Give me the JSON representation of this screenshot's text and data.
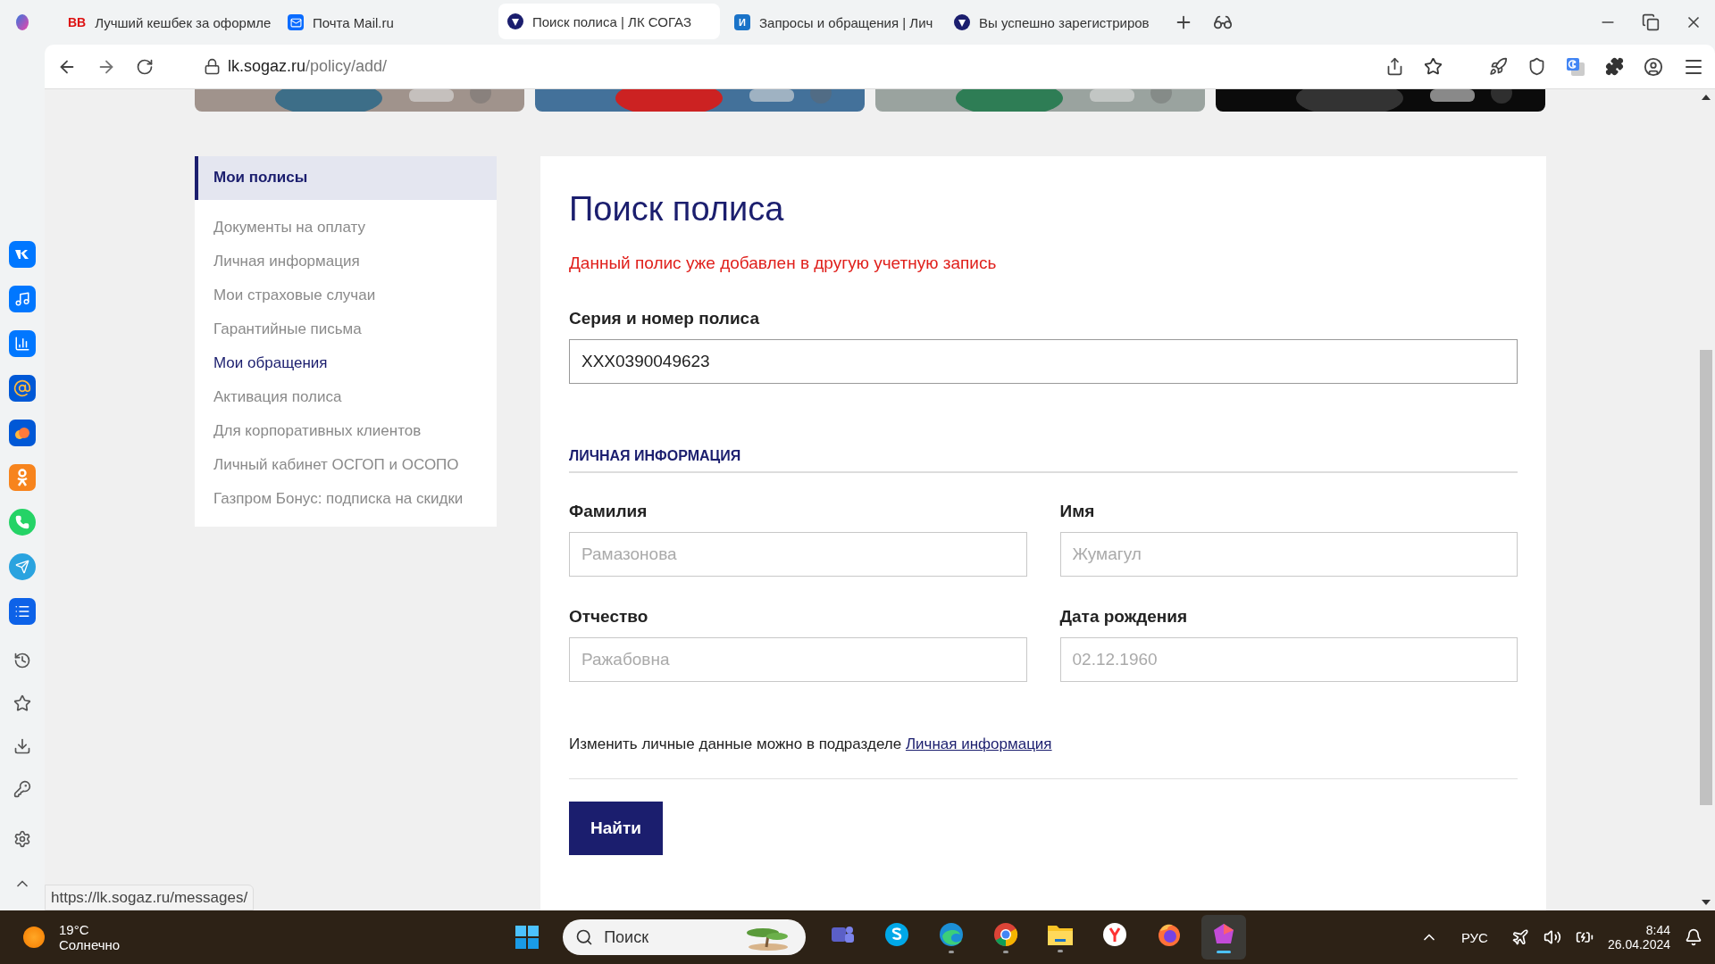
{
  "browser": {
    "tabs": [
      {
        "title": "Лучший кешбек за оформле",
        "kind": "text",
        "favicon": "BB",
        "selected": false
      },
      {
        "title": "Почта Mail.ru",
        "kind": "mail",
        "selected": false
      },
      {
        "title": "Поиск полиса | ЛК СОГАЗ",
        "kind": "logo",
        "selected": true
      },
      {
        "title": "Запросы и обращения | Лич",
        "kind": "letter",
        "favicon": "И",
        "selected": false
      },
      {
        "title": "Вы успешно зарегистриров",
        "kind": "logo",
        "selected": false
      }
    ],
    "address": {
      "host": "lk.sogaz.ru",
      "path": "/policy/add/"
    },
    "status_url": "https://lk.sogaz.ru/messages/"
  },
  "menu": [
    {
      "label": "Мои полисы",
      "selected": true,
      "hovered": false
    },
    {
      "label": "Документы на оплату",
      "selected": false,
      "hovered": false
    },
    {
      "label": "Личная информация",
      "selected": false,
      "hovered": false
    },
    {
      "label": "Мои страховые случаи",
      "selected": false,
      "hovered": false
    },
    {
      "label": "Гарантийные письма",
      "selected": false,
      "hovered": false
    },
    {
      "label": "Мои обращения",
      "selected": false,
      "hovered": true
    },
    {
      "label": "Активация полиса",
      "selected": false,
      "hovered": false
    },
    {
      "label": "Для корпоративных клиентов",
      "selected": false,
      "hovered": false
    },
    {
      "label": "Личный кабинет ОСГОП и ОСОПО",
      "selected": false,
      "hovered": false
    },
    {
      "label": "Газпром Бонус: подписка на скидки",
      "selected": false,
      "hovered": false
    }
  ],
  "form": {
    "title": "Поиск полиса",
    "error": "Данный полис уже добавлен в другую учетную запись",
    "policy": {
      "label": "Серия и номер полиса",
      "value": "XXX0390049623"
    },
    "section": "ЛИЧНАЯ ИНФОРМАЦИЯ",
    "fields": [
      {
        "label": "Фамилия",
        "placeholder": "Рамазонова"
      },
      {
        "label": "Имя",
        "placeholder": "Жумагул"
      },
      {
        "label": "Отчество",
        "placeholder": "Ражабовна"
      },
      {
        "label": "Дата рождения",
        "placeholder": "02.12.1960"
      }
    ],
    "note": "Изменить личные данные можно в подразделе",
    "note_link": "Личная информация",
    "submit": "Найти"
  },
  "taskbar": {
    "weather": {
      "temp": "19°C",
      "text": "Солнечно"
    },
    "search": {
      "placeholder": "Поиск"
    },
    "apps": [
      {
        "kind": "teams",
        "running": false,
        "selected": false
      },
      {
        "kind": "skype",
        "running": false,
        "selected": false
      },
      {
        "kind": "edge",
        "running": true,
        "selected": false
      },
      {
        "kind": "chrome",
        "running": true,
        "selected": false
      },
      {
        "kind": "folder",
        "running": true,
        "selected": false
      },
      {
        "kind": "yandex",
        "running": false,
        "selected": false
      },
      {
        "kind": "firefox",
        "running": false,
        "selected": false
      },
      {
        "kind": "gem",
        "running": true,
        "selected": true
      }
    ],
    "lang": "РУС",
    "time": "8:44",
    "date": "26.04.2024"
  }
}
